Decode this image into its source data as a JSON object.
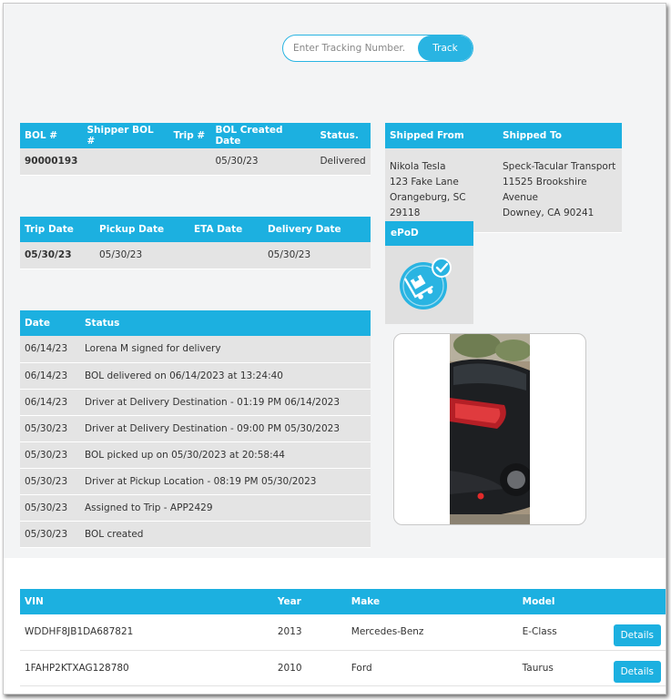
{
  "search": {
    "placeholder": "Enter Tracking Number.",
    "button": "Track"
  },
  "bol": {
    "headers": [
      "BOL #",
      "Shipper BOL #",
      "Trip #",
      "BOL Created Date",
      "Status."
    ],
    "row": [
      "90000193",
      "",
      "",
      "05/30/23",
      "Delivered"
    ]
  },
  "shipping": {
    "headers": [
      "Shipped From",
      "Shipped To"
    ],
    "from": [
      "Nikola Tesla",
      "123 Fake Lane",
      "Orangeburg, SC 29118"
    ],
    "to": [
      "Speck-Tacular Transport",
      "11525 Brookshire Avenue",
      "Downey, CA 90241"
    ]
  },
  "trip": {
    "headers": [
      "Trip Date",
      "Pickup Date",
      "ETA Date",
      "Delivery Date"
    ],
    "row": [
      "05/30/23",
      "05/30/23",
      "",
      "05/30/23"
    ]
  },
  "epod": {
    "label": "ePoD",
    "icon": "delivery-confirmed-icon"
  },
  "history": {
    "headers": [
      "Date",
      "Status"
    ],
    "rows": [
      [
        "06/14/23",
        "Lorena M signed for delivery"
      ],
      [
        "06/14/23",
        "BOL delivered on 06/14/2023 at 13:24:40"
      ],
      [
        "06/14/23",
        "Driver at Delivery Destination - 01:19 PM 06/14/2023"
      ],
      [
        "05/30/23",
        "Driver at Delivery Destination - 09:00 PM 05/30/2023"
      ],
      [
        "05/30/23",
        "BOL picked up on 05/30/2023 at 20:58:44"
      ],
      [
        "05/30/23",
        "Driver at Pickup Location - 08:19 PM 05/30/2023"
      ],
      [
        "05/30/23",
        "Assigned to Trip - APP2429"
      ],
      [
        "05/30/23",
        "BOL created"
      ]
    ]
  },
  "vehicles": {
    "headers": [
      "VIN",
      "Year",
      "Make",
      "Model",
      ""
    ],
    "rows": [
      {
        "vin": "WDDHF8JB1DA687821",
        "year": "2013",
        "make": "Mercedes-Benz",
        "model": "E-Class",
        "action": "Details"
      },
      {
        "vin": "1FAHP2KTXAG128780",
        "year": "2010",
        "make": "Ford",
        "model": "Taurus",
        "action": "Details"
      }
    ]
  },
  "colors": {
    "accent": "#1cb0e0",
    "cell": "#e4e4e4",
    "page": "#f3f4f5"
  }
}
